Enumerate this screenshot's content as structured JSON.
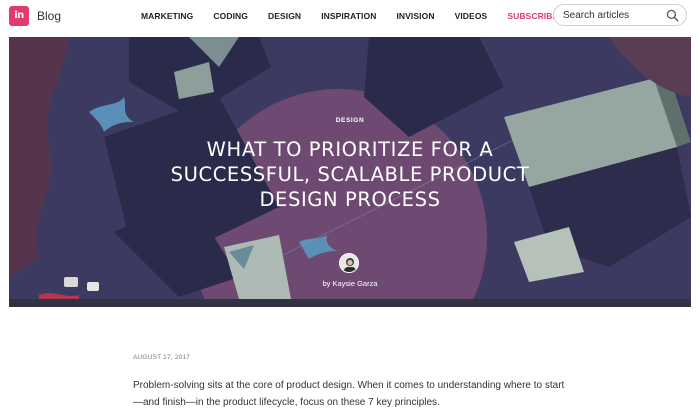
{
  "header": {
    "logo_text": "in",
    "brand": "Blog",
    "nav": [
      "MARKETING",
      "CODING",
      "DESIGN",
      "INSPIRATION",
      "INVISION",
      "VIDEOS"
    ],
    "subscribe": "SUBSCRIBE",
    "search_placeholder": "Search articles",
    "search_icon": "search-icon"
  },
  "hero": {
    "category": "DESIGN",
    "title": "WHAT TO PRIORITIZE FOR A SUCCESSFUL, SCALABLE PRODUCT DESIGN PROCESS",
    "byline": "by Kaysie Garza",
    "colors": {
      "background": "#3d3a61",
      "circle": "#6e4a72",
      "accent": "#e33a6d"
    }
  },
  "article": {
    "date": "AUGUST 17, 2017",
    "intro": "Problem-solving sits at the core of product design. When it comes to understanding where to start—and finish—in the product lifecycle, focus on these 7 key principles."
  }
}
